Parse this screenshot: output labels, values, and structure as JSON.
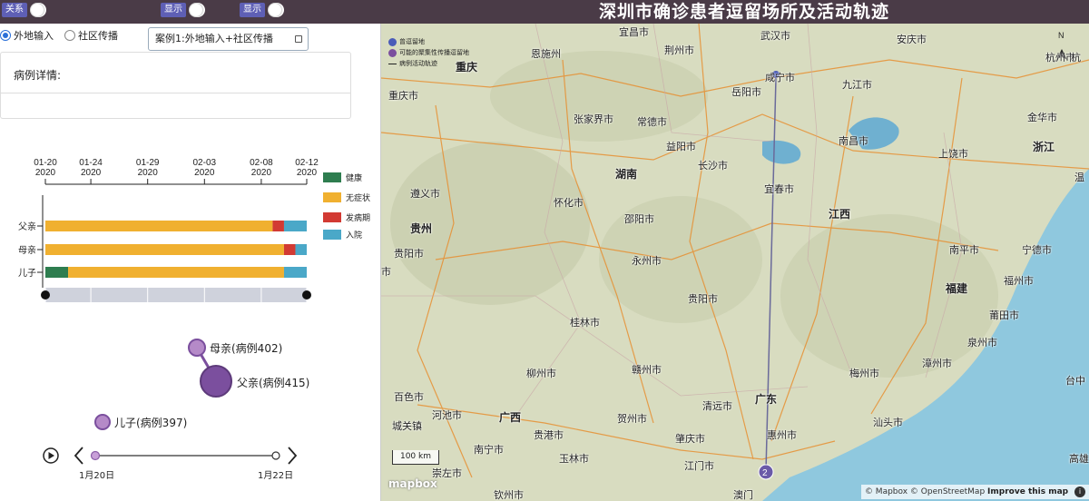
{
  "topbar": {
    "title": "深圳市确诊患者逗留场所及活动轨迹",
    "toggles": [
      {
        "label": "关系"
      },
      {
        "label": "显示"
      },
      {
        "label": "显示"
      }
    ]
  },
  "controls": {
    "radios": [
      {
        "label": "外地输入",
        "checked": true
      },
      {
        "label": "社区传播",
        "checked": false
      }
    ],
    "case_select": "案例1:外地输入+社区传播"
  },
  "detail": {
    "title": "病例详情:"
  },
  "chart_data": {
    "type": "bar",
    "orientation": "horizontal-stacked-timeline",
    "x_ticks": [
      {
        "date": "01-20",
        "year": "2020"
      },
      {
        "date": "01-24",
        "year": "2020"
      },
      {
        "date": "01-29",
        "year": "2020"
      },
      {
        "date": "02-03",
        "year": "2020"
      },
      {
        "date": "02-08",
        "year": "2020"
      },
      {
        "date": "02-12",
        "year": "2020"
      }
    ],
    "categories": [
      "父亲",
      "母亲",
      "儿子"
    ],
    "legend": [
      {
        "name": "健康",
        "color": "#2e7d4f"
      },
      {
        "name": "无症状",
        "color": "#f0b030"
      },
      {
        "name": "发病期",
        "color": "#d23a33"
      },
      {
        "name": "入院",
        "color": "#4aa8c8"
      }
    ],
    "rows": [
      {
        "name": "父亲",
        "segments": [
          {
            "state": "无症状",
            "start": "2020-01-20",
            "end": "2020-02-09"
          },
          {
            "state": "发病期",
            "start": "2020-02-09",
            "end": "2020-02-10"
          },
          {
            "state": "入院",
            "start": "2020-02-10",
            "end": "2020-02-12"
          }
        ]
      },
      {
        "name": "母亲",
        "segments": [
          {
            "state": "无症状",
            "start": "2020-01-20",
            "end": "2020-02-10"
          },
          {
            "state": "发病期",
            "start": "2020-02-10",
            "end": "2020-02-11"
          },
          {
            "state": "入院",
            "start": "2020-02-11",
            "end": "2020-02-12"
          }
        ]
      },
      {
        "name": "儿子",
        "segments": [
          {
            "state": "健康",
            "start": "2020-01-20",
            "end": "2020-01-22"
          },
          {
            "state": "无症状",
            "start": "2020-01-22",
            "end": "2020-02-10"
          },
          {
            "state": "入院",
            "start": "2020-02-10",
            "end": "2020-02-12"
          }
        ]
      }
    ],
    "xlim": [
      "2020-01-20",
      "2020-02-12"
    ]
  },
  "network": {
    "nodes": [
      {
        "id": "mother",
        "label": "母亲(病例402)",
        "size": "small"
      },
      {
        "id": "father",
        "label": "父亲(病例415)",
        "size": "large"
      },
      {
        "id": "son",
        "label": "儿子(病例397)",
        "size": "small"
      }
    ],
    "links": [
      {
        "source": "mother",
        "target": "father"
      }
    ],
    "node_color": "#7b4f9e"
  },
  "timeline": {
    "start_label": "1月20日",
    "end_label": "1月22日",
    "progress": 0
  },
  "map": {
    "legend": [
      {
        "label": "曾逗留地",
        "color": "#4a5bb8"
      },
      {
        "label": "可能的聚集性传播逗留地",
        "color": "#7b4f9e"
      },
      {
        "label": "病例活动轨迹",
        "type": "line"
      }
    ],
    "cities": [
      {
        "name": "宜昌市"
      },
      {
        "name": "武汉市"
      },
      {
        "name": "安庆市"
      },
      {
        "name": "恩施州"
      },
      {
        "name": "荆州市"
      },
      {
        "name": "杭州市"
      },
      {
        "name": "重庆"
      },
      {
        "name": "咸宁市"
      },
      {
        "name": "重庆市"
      },
      {
        "name": "岳阳市"
      },
      {
        "name": "九江市"
      },
      {
        "name": "张家界市"
      },
      {
        "name": "常德市"
      },
      {
        "name": "金华市"
      },
      {
        "name": "益阳市"
      },
      {
        "name": "南昌市"
      },
      {
        "name": "长沙市"
      },
      {
        "name": "上饶市"
      },
      {
        "name": "宜春市"
      },
      {
        "name": "遵义市"
      },
      {
        "name": "怀化市"
      },
      {
        "name": "邵阳市"
      },
      {
        "name": "南平市"
      },
      {
        "name": "宁德市"
      },
      {
        "name": "贵阳市"
      },
      {
        "name": "永州市"
      },
      {
        "name": "福州市"
      },
      {
        "name": "贵阳市"
      },
      {
        "name": "莆田市"
      },
      {
        "name": "桂林市"
      },
      {
        "name": "泉州市"
      },
      {
        "name": "赣州市"
      },
      {
        "name": "柳州市"
      },
      {
        "name": "梅州市"
      },
      {
        "name": "漳州市"
      },
      {
        "name": "百色市"
      },
      {
        "name": "清远市"
      },
      {
        "name": "贺州市"
      },
      {
        "name": "汕头市"
      },
      {
        "name": "河池市"
      },
      {
        "name": "惠州市"
      },
      {
        "name": "城关镇"
      },
      {
        "name": "贵港市"
      },
      {
        "name": "肇庆市"
      },
      {
        "name": "南宁市"
      },
      {
        "name": "玉林市"
      },
      {
        "name": "江门市"
      },
      {
        "name": "崇左市"
      },
      {
        "name": "钦州市"
      },
      {
        "name": "澳门"
      }
    ],
    "provinces": [
      {
        "name": "湖南"
      },
      {
        "name": "江西"
      },
      {
        "name": "浙江"
      },
      {
        "name": "贵州"
      },
      {
        "name": "福建"
      },
      {
        "name": "广西"
      },
      {
        "name": "广东"
      }
    ],
    "edge_labels": [
      "杭",
      "台中",
      "高雄",
      "温",
      "市"
    ],
    "markers": [
      {
        "label": "2"
      }
    ],
    "scale": "100 km",
    "north": "N",
    "logo": "mapbox",
    "attribution_1": "© Mapbox © OpenStreetMap",
    "attribution_2": "Improve this map",
    "info": "i",
    "colors": {
      "land": "#d8dcc0",
      "sea": "#8fc8de",
      "road": "#e88b2a",
      "track": "#6a6a9a"
    }
  }
}
